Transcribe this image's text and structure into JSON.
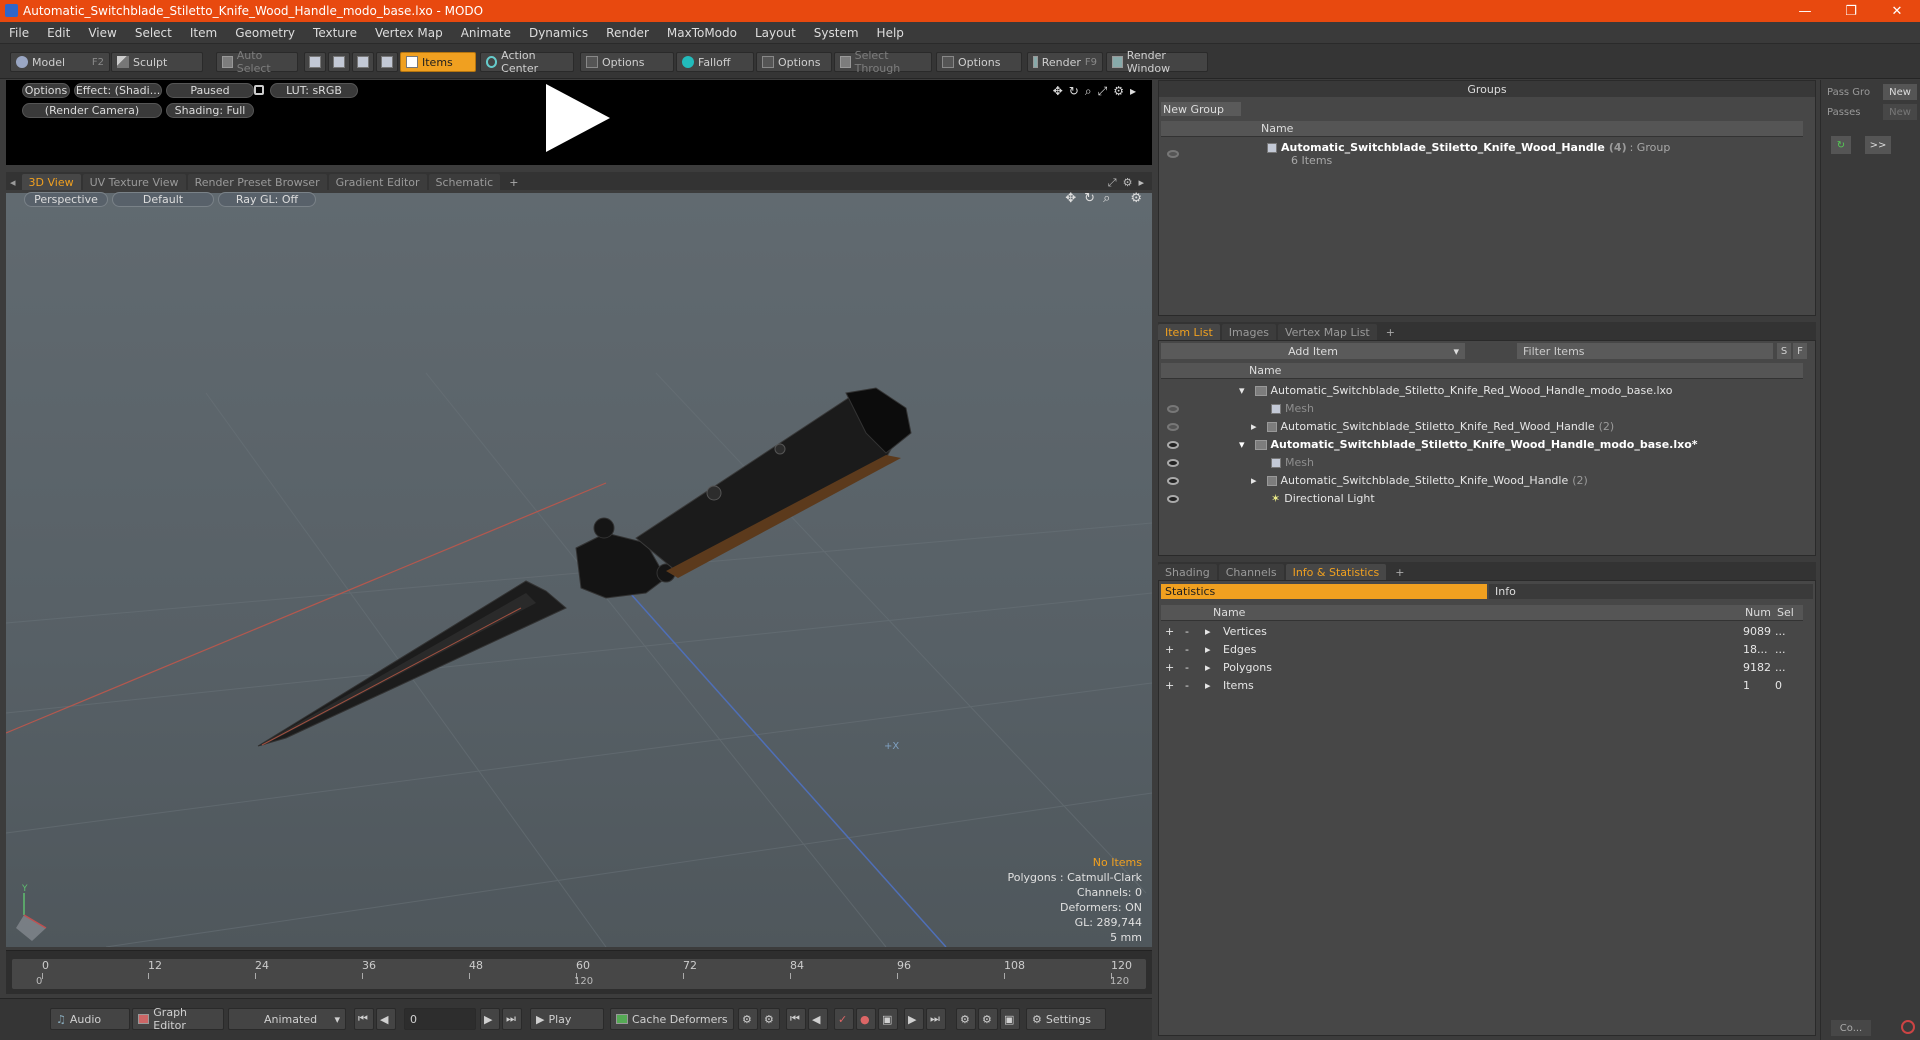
{
  "window": {
    "title": "Automatic_Switchblade_Stiletto_Knife_Wood_Handle_modo_base.lxo - MODO",
    "minimize": "—",
    "maximize": "❐",
    "close": "✕"
  },
  "menu": [
    "File",
    "Edit",
    "View",
    "Select",
    "Item",
    "Geometry",
    "Texture",
    "Vertex Map",
    "Animate",
    "Dynamics",
    "Render",
    "MaxToModo",
    "Layout",
    "System",
    "Help"
  ],
  "toolbar": {
    "model": "Model",
    "model_key": "F2",
    "sculpt": "Sculpt",
    "auto_select": "Auto Select",
    "items": "Items",
    "action_center": "Action Center",
    "options1": "Options",
    "falloff": "Falloff",
    "options2": "Options",
    "select_through": "Select Through",
    "options3": "Options",
    "render": "Render",
    "render_key": "F9",
    "render_window": "Render Window"
  },
  "preview": {
    "options": "Options",
    "effect": "Effect: (Shadi...",
    "paused": "Paused",
    "lut": "LUT: sRGB",
    "camera": "(Render Camera)",
    "shading": "Shading: Full"
  },
  "viewtabs": [
    "3D View",
    "UV Texture View",
    "Render Preset Browser",
    "Gradient Editor",
    "Schematic",
    "+"
  ],
  "viewport": {
    "perspective": "Perspective",
    "default": "Default",
    "raygl": "Ray GL: Off",
    "info": {
      "no_items": "No Items",
      "polygons": "Polygons : Catmull-Clark",
      "channels": "Channels: 0",
      "deformers": "Deformers: ON",
      "gl": "GL: 289,744",
      "scale": "5 mm"
    },
    "axis_y": "Y",
    "axis_x": "X"
  },
  "timeline": {
    "ticks": [
      "0",
      "12",
      "24",
      "36",
      "48",
      "60",
      "72",
      "84",
      "96",
      "108",
      "120"
    ],
    "bottom_ticks": [
      "0",
      "120",
      "120"
    ]
  },
  "bottombar": {
    "audio": "Audio",
    "graph_editor": "Graph Editor",
    "animated": "Animated",
    "frame": "0",
    "play": "Play",
    "cache_deformers": "Cache Deformers",
    "settings": "Settings"
  },
  "groups": {
    "title": "Groups",
    "new_group": "New Group",
    "col_name": "Name",
    "item_name": "Automatic_Switchblade_Stiletto_Knife_Wood_Handle",
    "item_count": "(4)",
    "item_type": ": Group",
    "item_sub": "6 Items"
  },
  "itemlist": {
    "tabs": [
      "Item List",
      "Images",
      "Vertex Map List",
      "+"
    ],
    "add_item": "Add Item",
    "filter": "Filter Items",
    "s": "S",
    "f": "F",
    "col_name": "Name",
    "rows": [
      {
        "name": "Automatic_Switchblade_Stiletto_Knife_Red_Wood_Handle_modo_base.lxo",
        "count": ""
      },
      {
        "name": "Mesh",
        "count": ""
      },
      {
        "name": "Automatic_Switchblade_Stiletto_Knife_Red_Wood_Handle",
        "count": "(2)"
      },
      {
        "name": "Automatic_Switchblade_Stiletto_Knife_Wood_Handle_modo_base.lxo*",
        "count": ""
      },
      {
        "name": "Mesh",
        "count": ""
      },
      {
        "name": "Automatic_Switchblade_Stiletto_Knife_Wood_Handle",
        "count": "(2)"
      },
      {
        "name": "Directional Light",
        "count": ""
      }
    ]
  },
  "stats": {
    "tabs": [
      "Shading",
      "Channels",
      "Info & Statistics",
      "+"
    ],
    "statistics": "Statistics",
    "info": "Info",
    "col_name": "Name",
    "col_num": "Num",
    "col_sel": "Sel",
    "rows": [
      {
        "name": "Vertices",
        "num": "9089",
        "sel": "..."
      },
      {
        "name": "Edges",
        "num": "18...",
        "sel": "..."
      },
      {
        "name": "Polygons",
        "num": "9182",
        "sel": "..."
      },
      {
        "name": "Items",
        "num": "1",
        "sel": "0"
      }
    ]
  },
  "farright": {
    "pass_group": "Pass Gro",
    "new1": "New",
    "passes": "Passes",
    "new2": "New",
    "expand": ">>",
    "co": "Co..."
  },
  "colors": {
    "accent": "#f0a020",
    "titlebar": "#e8490f"
  }
}
